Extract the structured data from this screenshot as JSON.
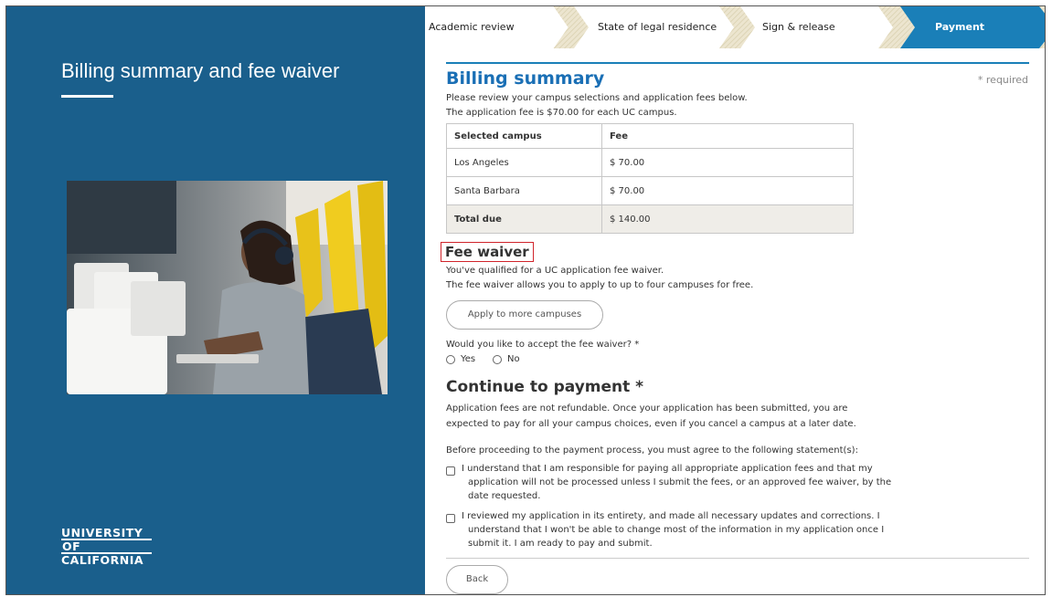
{
  "left_panel": {
    "title": "Billing summary and fee waiver",
    "logo_lines": [
      "UNIVERSITY",
      "OF",
      "CALIFORNIA"
    ],
    "photo_alt": "student at computer",
    "background_color": "#1a5f8c"
  },
  "steps": {
    "items": [
      {
        "label": "Academic review",
        "state": "done"
      },
      {
        "label": "State of legal residence",
        "state": "done"
      },
      {
        "label": "Sign & release",
        "state": "done"
      },
      {
        "label": "Payment",
        "state": "active"
      }
    ],
    "active_color": "#1a7fb8"
  },
  "billing": {
    "heading": "Billing summary",
    "required_note": "* required",
    "intro_line1": "Please review your campus selections and application fees below.",
    "intro_line2": "The application fee is $70.00 for each UC campus.",
    "table": {
      "headers": [
        "Selected campus",
        "Fee"
      ],
      "rows": [
        [
          "Los Angeles",
          "$ 70.00"
        ],
        [
          "Santa Barbara",
          "$ 70.00"
        ]
      ],
      "total": [
        "Total due",
        "$ 140.00"
      ]
    }
  },
  "fee_waiver": {
    "heading": "Fee waiver",
    "line1": "You've qualified for a UC application fee waiver.",
    "line2": "The fee waiver allows you to apply to up to four campuses for free.",
    "apply_button": "Apply to more campuses",
    "question": "Would you like to accept the fee waiver? *",
    "options": [
      "Yes",
      "No"
    ],
    "highlight_color": "#d0242b"
  },
  "payment": {
    "heading": "Continue to payment *",
    "note_line1": "Application fees are not refundable. Once your application has been submitted, you are",
    "note_line2": "expected to pay for all your campus choices, even if you cancel a campus at a later date.",
    "agree_intro": "Before proceeding to the payment process, you must agree to the following statement(s):",
    "statements": [
      {
        "line1": "I understand that I am responsible for paying all appropriate application fees and that my",
        "line2": "application will not be processed unless I submit the fees, or an approved fee waiver, by the",
        "line3": "date requested."
      },
      {
        "line1": "I reviewed my application in its entirety, and made all necessary updates and corrections. I",
        "line2": "understand that I won't be able to change most of the information in my application once I",
        "line3": "submit it. I am ready to pay and submit."
      }
    ],
    "back_button": "Back"
  }
}
